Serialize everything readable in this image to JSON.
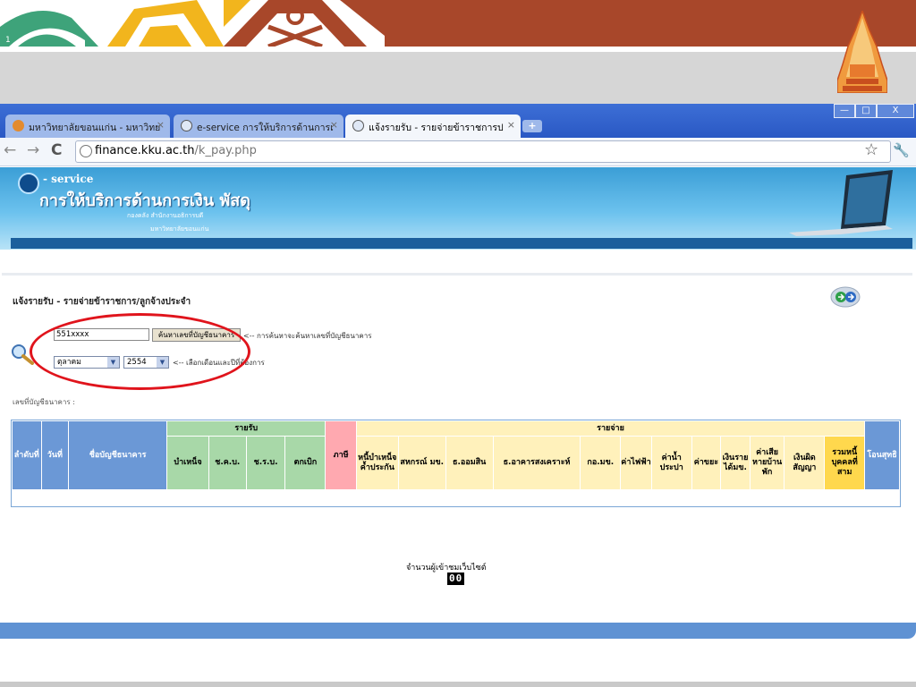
{
  "slide": {
    "number": "1"
  },
  "browser": {
    "tabs": [
      {
        "label": "มหาวิทยาลัยขอนแก่น - มหาวิทย",
        "state": "inactive",
        "icon": "flame-icon"
      },
      {
        "label": "e-service การให้บริการด้านการเ",
        "state": "inactive",
        "icon": "globe-icon"
      },
      {
        "label": "แจ้งรายรับ - รายจ่ายข้าราชการป",
        "state": "active",
        "icon": "globe-icon"
      }
    ],
    "tab_close": "×",
    "new_tab": "+",
    "window_buttons": [
      "—",
      "□",
      "X"
    ],
    "url_host": "finance.kku.ac.th",
    "url_path": "/k_pay.php"
  },
  "site": {
    "service_word": "- service",
    "title": "การให้บริการด้านการเงิน พัสดุ",
    "subtitle1": "กองคลัง สำนักงานอธิการบดี",
    "subtitle2": "มหาวิทยาลัยขอนแก่น"
  },
  "page": {
    "heading": "แจ้งรายรับ - รายจ่ายข้าราชการ/ลูกจ้างประจำ",
    "account_input": "551xxxx",
    "search_button": "ค้นหาเลขที่บัญชีธนาคาร",
    "search_hint": "<-- การค้นหาจะค้นหาเลขที่บัญชีธนาคาร",
    "month_select": "ตุลาคม",
    "year_select": "2554",
    "date_hint": "<-- เลือกเดือนและปีที่ต้องการ",
    "account_label": "เลขที่บัญชีธนาคาร :"
  },
  "table": {
    "col_no": "ลำดับที่",
    "col_date": "วันที่",
    "col_account": "ชื่อบัญชีธนาคาร",
    "income_group": "รายรับ",
    "income_cols": [
      "บำเหน็จ",
      "ช.ค.บ.",
      "ช.ร.บ.",
      "ตกเบิก"
    ],
    "tax": "ภาษี",
    "expense_group": "รายจ่าย",
    "expense_cols": [
      "หนี้บำเหน็จค้ำประกัน",
      "สหกรณ์ มข.",
      "ธ.ออมสิน",
      "ธ.อาคารสงเคราะห์",
      "กอ.มข.",
      "ค่าไฟฟ้า",
      "ค่าน้ำประปา",
      "ค่าขยะ",
      "เงินรายได้มข.",
      "ค่าเสียหายบ้านพัก",
      "เงินผิดสัญญา"
    ],
    "third_party": "รวมหนี้บุคคลที่สาม",
    "net_transfer": "โอนสุทธิ"
  },
  "footer": {
    "visitor_label": "จำนวนผู้เข้าชมเว็บไซต์",
    "visitor_count": "00"
  },
  "colors": {
    "banner": "#a8472a",
    "header_blue": "#3b9ed6",
    "table_blue": "#6b98d6",
    "income_green": "#a8d8a8",
    "tax_pink": "#ffa9b0",
    "expense_yellow": "#fff1bb",
    "total_gold": "#ffd84d",
    "annotation_red": "#e0141c"
  }
}
